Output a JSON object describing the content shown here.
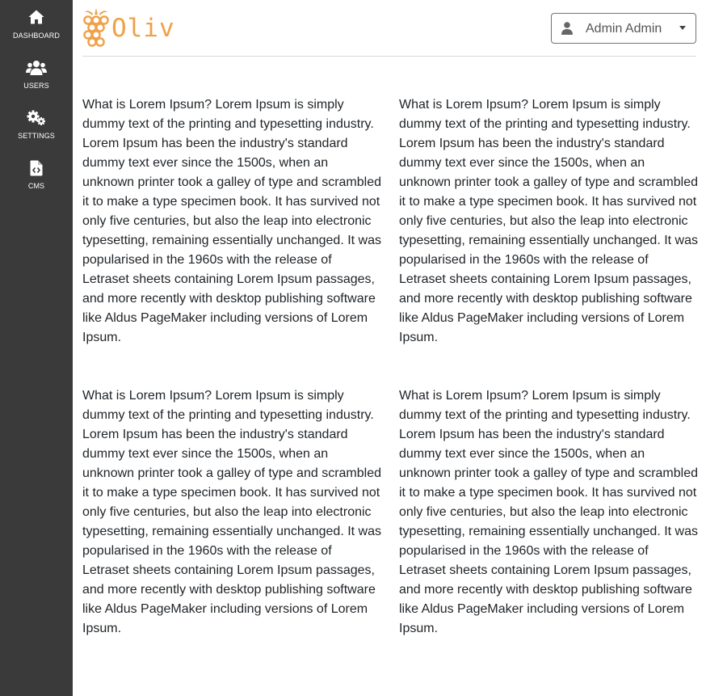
{
  "sidebar": {
    "items": [
      {
        "label": "DASHBOARD",
        "icon": "home-icon"
      },
      {
        "label": "USERS",
        "icon": "users-icon"
      },
      {
        "label": "SETTINGS",
        "icon": "cogs-icon"
      },
      {
        "label": "CMS",
        "icon": "code-file-icon"
      }
    ]
  },
  "header": {
    "logo_text": "Oliv",
    "user_menu": {
      "name": "Admin Admin",
      "icon": "user-icon"
    }
  },
  "content": {
    "paragraphs": [
      "What is Lorem Ipsum? Lorem Ipsum is simply dummy text of the printing and typesetting industry. Lorem Ipsum has been the industry's standard dummy text ever since the 1500s, when an unknown printer took a galley of type and scrambled it to make a type specimen book. It has survived not only five centuries, but also the leap into electronic typesetting, remaining essentially unchanged. It was popularised in the 1960s with the release of Letraset sheets containing Lorem Ipsum passages, and more recently with desktop publishing software like Aldus PageMaker including versions of Lorem Ipsum.",
      "What is Lorem Ipsum? Lorem Ipsum is simply dummy text of the printing and typesetting industry. Lorem Ipsum has been the industry's standard dummy text ever since the 1500s, when an unknown printer took a galley of type and scrambled it to make a type specimen book. It has survived not only five centuries, but also the leap into electronic typesetting, remaining essentially unchanged. It was popularised in the 1960s with the release of Letraset sheets containing Lorem Ipsum passages, and more recently with desktop publishing software like Aldus PageMaker including versions of Lorem Ipsum.",
      "What is Lorem Ipsum? Lorem Ipsum is simply dummy text of the printing and typesetting industry. Lorem Ipsum has been the industry's standard dummy text ever since the 1500s, when an unknown printer took a galley of type and scrambled it to make a type specimen book. It has survived not only five centuries, but also the leap into electronic typesetting, remaining essentially unchanged. It was popularised in the 1960s with the release of Letraset sheets containing Lorem Ipsum passages, and more recently with desktop publishing software like Aldus PageMaker including versions of Lorem Ipsum.",
      "What is Lorem Ipsum? Lorem Ipsum is simply dummy text of the printing and typesetting industry. Lorem Ipsum has been the industry's standard dummy text ever since the 1500s, when an unknown printer took a galley of type and scrambled it to make a type specimen book. It has survived not only five centuries, but also the leap into electronic typesetting, remaining essentially unchanged. It was popularised in the 1960s with the release of Letraset sheets containing Lorem Ipsum passages, and more recently with desktop publishing software like Aldus PageMaker including versions of Lorem Ipsum."
    ]
  },
  "colors": {
    "sidebar_bg": "#3a3a3a",
    "logo_accent": "#f0a046",
    "text": "#212529"
  }
}
